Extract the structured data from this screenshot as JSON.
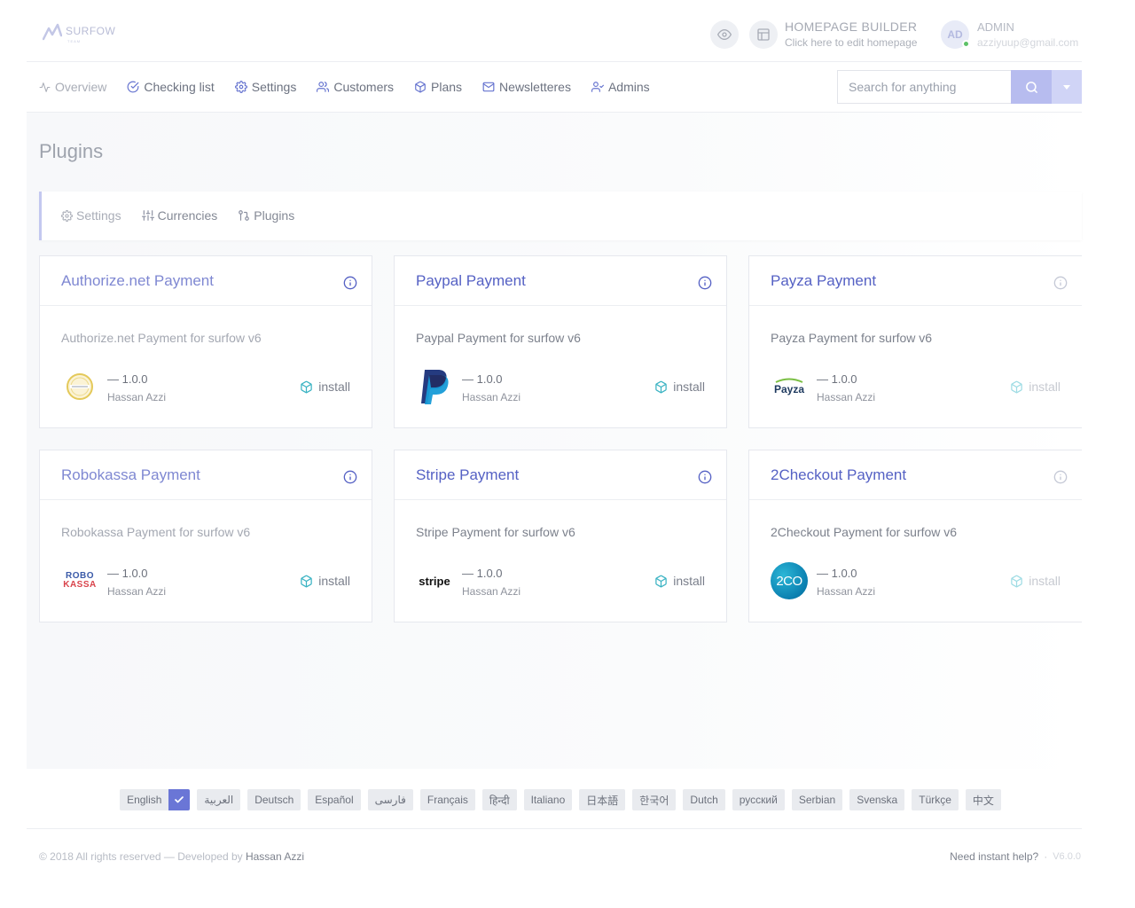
{
  "header": {
    "logo_text": "SURFOW",
    "logo_sub": "TEAM",
    "builder_title": "HOMEPAGE BUILDER",
    "builder_sub": "Click here to edit homepage",
    "avatar_initials": "AD",
    "admin_name": "ADMIN",
    "admin_email": "azziyuup@gmail.com"
  },
  "nav": {
    "items": [
      {
        "label": "Overview",
        "icon": "activity-icon"
      },
      {
        "label": "Checking list",
        "icon": "check-circle-icon"
      },
      {
        "label": "Settings",
        "icon": "gear-icon"
      },
      {
        "label": "Customers",
        "icon": "users-icon"
      },
      {
        "label": "Plans",
        "icon": "box-icon"
      },
      {
        "label": "Newsletteres",
        "icon": "mail-icon"
      },
      {
        "label": "Admins",
        "icon": "user-check-icon"
      }
    ],
    "search_placeholder": "Search for anything"
  },
  "page": {
    "title": "Plugins",
    "subtabs": [
      {
        "label": "Settings",
        "icon": "gear-icon"
      },
      {
        "label": "Currencies",
        "icon": "sliders-icon"
      },
      {
        "label": "Plugins",
        "icon": "git-pull-request-icon"
      }
    ]
  },
  "plugins": [
    {
      "title": "Authorize.net Payment",
      "desc": "Authorize.net Payment for surfow v6",
      "version": "— 1.0.0",
      "author": "Hassan Azzi",
      "install": "install",
      "logo": "authorize-net-logo"
    },
    {
      "title": "Paypal Payment",
      "desc": "Paypal Payment for surfow v6",
      "version": "— 1.0.0",
      "author": "Hassan Azzi",
      "install": "install",
      "logo": "paypal-logo"
    },
    {
      "title": "Payza Payment",
      "desc": "Payza Payment for surfow v6",
      "version": "— 1.0.0",
      "author": "Hassan Azzi",
      "install": "install",
      "logo": "payza-logo",
      "logo_text": "Payza"
    },
    {
      "title": "Robokassa Payment",
      "desc": "Robokassa Payment for surfow v6",
      "version": "— 1.0.0",
      "author": "Hassan Azzi",
      "install": "install",
      "logo": "robokassa-logo",
      "logo_text_1": "ROBO",
      "logo_text_2": "KASSA"
    },
    {
      "title": "Stripe Payment",
      "desc": "Stripe Payment for surfow v6",
      "version": "— 1.0.0",
      "author": "Hassan Azzi",
      "install": "install",
      "logo": "stripe-logo",
      "logo_text": "stripe"
    },
    {
      "title": "2Checkout Payment",
      "desc": "2Checkout Payment for surfow v6",
      "version": "— 1.0.0",
      "author": "Hassan Azzi",
      "install": "install",
      "logo": "2checkout-logo",
      "logo_text": "2CO"
    }
  ],
  "languages": [
    "English",
    "العربية",
    "Deutsch",
    "Español",
    "فارسی",
    "Français",
    "हिन्दी",
    "Italiano",
    "日本語",
    "한국어",
    "Dutch",
    "русский",
    "Serbian",
    "Svenska",
    "Türkçe",
    "中文"
  ],
  "selected_language": "English",
  "footer": {
    "copyright": "© 2018 All rights reserved — Developed by ",
    "developer": "Hassan Azzi",
    "help": "Need instant help?",
    "separator": "·",
    "version": "V6.0.0"
  },
  "colors": {
    "accent": "#5561c4",
    "install_icon": "#3bb3c3",
    "search_button": "#b7bcef",
    "online_dot": "#5ec268"
  }
}
